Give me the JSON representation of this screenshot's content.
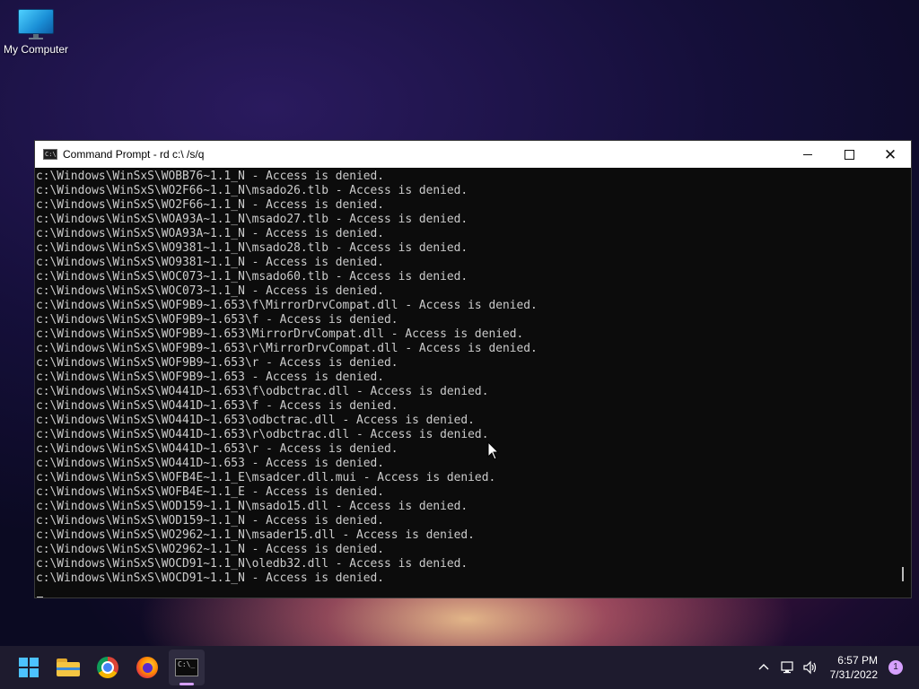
{
  "desktop": {
    "icons": [
      {
        "label": "My Computer"
      }
    ]
  },
  "window": {
    "title": "Command Prompt - rd  c:\\ /s/q",
    "controls": {
      "minimize": "minimize",
      "maximize": "maximize",
      "close": "close"
    }
  },
  "console": {
    "lines": [
      "c:\\Windows\\WinSxS\\WOBB76~1.1_N - Access is denied.",
      "c:\\Windows\\WinSxS\\WO2F66~1.1_N\\msado26.tlb - Access is denied.",
      "c:\\Windows\\WinSxS\\WO2F66~1.1_N - Access is denied.",
      "c:\\Windows\\WinSxS\\WOA93A~1.1_N\\msado27.tlb - Access is denied.",
      "c:\\Windows\\WinSxS\\WOA93A~1.1_N - Access is denied.",
      "c:\\Windows\\WinSxS\\WO9381~1.1_N\\msado28.tlb - Access is denied.",
      "c:\\Windows\\WinSxS\\WO9381~1.1_N - Access is denied.",
      "c:\\Windows\\WinSxS\\WOC073~1.1_N\\msado60.tlb - Access is denied.",
      "c:\\Windows\\WinSxS\\WOC073~1.1_N - Access is denied.",
      "c:\\Windows\\WinSxS\\WOF9B9~1.653\\f\\MirrorDrvCompat.dll - Access is denied.",
      "c:\\Windows\\WinSxS\\WOF9B9~1.653\\f - Access is denied.",
      "c:\\Windows\\WinSxS\\WOF9B9~1.653\\MirrorDrvCompat.dll - Access is denied.",
      "c:\\Windows\\WinSxS\\WOF9B9~1.653\\r\\MirrorDrvCompat.dll - Access is denied.",
      "c:\\Windows\\WinSxS\\WOF9B9~1.653\\r - Access is denied.",
      "c:\\Windows\\WinSxS\\WOF9B9~1.653 - Access is denied.",
      "c:\\Windows\\WinSxS\\WO441D~1.653\\f\\odbctrac.dll - Access is denied.",
      "c:\\Windows\\WinSxS\\WO441D~1.653\\f - Access is denied.",
      "c:\\Windows\\WinSxS\\WO441D~1.653\\odbctrac.dll - Access is denied.",
      "c:\\Windows\\WinSxS\\WO441D~1.653\\r\\odbctrac.dll - Access is denied.",
      "c:\\Windows\\WinSxS\\WO441D~1.653\\r - Access is denied.",
      "c:\\Windows\\WinSxS\\WO441D~1.653 - Access is denied.",
      "c:\\Windows\\WinSxS\\WOFB4E~1.1_E\\msadcer.dll.mui - Access is denied.",
      "c:\\Windows\\WinSxS\\WOFB4E~1.1_E - Access is denied.",
      "c:\\Windows\\WinSxS\\WOD159~1.1_N\\msado15.dll - Access is denied.",
      "c:\\Windows\\WinSxS\\WOD159~1.1_N - Access is denied.",
      "c:\\Windows\\WinSxS\\WO2962~1.1_N\\msader15.dll - Access is denied.",
      "c:\\Windows\\WinSxS\\WO2962~1.1_N - Access is denied.",
      "c:\\Windows\\WinSxS\\WOCD91~1.1_N\\oledb32.dll - Access is denied.",
      "c:\\Windows\\WinSxS\\WOCD91~1.1_N - Access is denied."
    ]
  },
  "taskbar": {
    "apps": [
      {
        "name": "start",
        "icon": "windows-start-icon"
      },
      {
        "name": "file-explorer",
        "icon": "folder-icon"
      },
      {
        "name": "chrome",
        "icon": "chrome-icon"
      },
      {
        "name": "firefox",
        "icon": "firefox-icon"
      },
      {
        "name": "command-prompt",
        "icon": "cmd-icon",
        "active": true
      }
    ],
    "tray": {
      "icons": [
        "chevron-up-icon",
        "network-icon",
        "volume-icon"
      ],
      "time": "6:57 PM",
      "date": "7/31/2022",
      "notification_count": "1"
    }
  },
  "colors": {
    "console_bg": "#0c0c0c",
    "console_text": "#cccccc",
    "start_accent": "#4cc2ff",
    "active_indicator": "#d6a0ff"
  }
}
